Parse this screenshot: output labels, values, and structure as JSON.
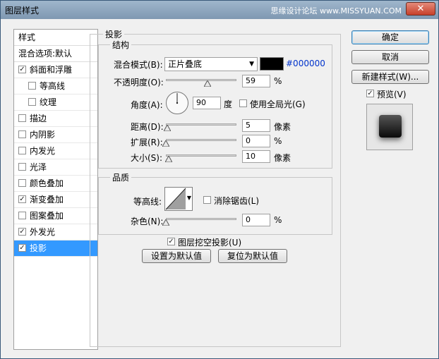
{
  "window": {
    "title": "图层样式",
    "watermark": "思缘设计论坛 www.MISSYUAN.COM"
  },
  "left_panel": {
    "header": "样式",
    "blend_options": "混合选项:默认",
    "items": [
      {
        "label": "斜面和浮雕",
        "checked": true,
        "sub": false
      },
      {
        "label": "等高线",
        "checked": false,
        "sub": true
      },
      {
        "label": "纹理",
        "checked": false,
        "sub": true
      },
      {
        "label": "描边",
        "checked": false,
        "sub": false
      },
      {
        "label": "内阴影",
        "checked": false,
        "sub": false
      },
      {
        "label": "内发光",
        "checked": false,
        "sub": false
      },
      {
        "label": "光泽",
        "checked": false,
        "sub": false
      },
      {
        "label": "颜色叠加",
        "checked": false,
        "sub": false
      },
      {
        "label": "渐变叠加",
        "checked": true,
        "sub": false
      },
      {
        "label": "图案叠加",
        "checked": false,
        "sub": false
      },
      {
        "label": "外发光",
        "checked": true,
        "sub": false
      },
      {
        "label": "投影",
        "checked": true,
        "sub": false,
        "active": true
      }
    ]
  },
  "drop_shadow": {
    "title": "投影",
    "structure": {
      "title": "结构",
      "blend_mode_label": "混合模式(B):",
      "blend_mode_value": "正片叠底",
      "color_hex": "#000000",
      "color_value": "#000000",
      "opacity_label": "不透明度(O):",
      "opacity_value": "59",
      "opacity_unit": "%",
      "opacity_level": 0.59,
      "angle_label": "角度(A):",
      "angle_value": "90",
      "angle_unit": "度",
      "global_light_label": "使用全局光(G)",
      "global_light_checked": false,
      "distance_label": "距离(D):",
      "distance_value": "5",
      "distance_unit": "像素",
      "distance_level": 0.02,
      "spread_label": "扩展(R):",
      "spread_value": "0",
      "spread_unit": "%",
      "spread_level": 0.0,
      "size_label": "大小(S):",
      "size_value": "10",
      "size_unit": "像素",
      "size_level": 0.04
    },
    "quality": {
      "title": "品质",
      "contour_label": "等高线:",
      "antialias_label": "消除锯齿(L)",
      "antialias_checked": false,
      "noise_label": "杂色(N):",
      "noise_value": "0",
      "noise_unit": "%",
      "noise_level": 0.0
    },
    "knockout_label": "图层挖空投影(U)",
    "knockout_checked": true,
    "make_default_label": "设置为默认值",
    "reset_default_label": "复位为默认值"
  },
  "buttons": {
    "ok": "确定",
    "cancel": "取消",
    "new_style": "新建样式(W)...",
    "preview_label": "预览(V)",
    "preview_checked": true
  },
  "colors": {
    "accent": "#3399ff",
    "hex_text": "#0033cc"
  }
}
